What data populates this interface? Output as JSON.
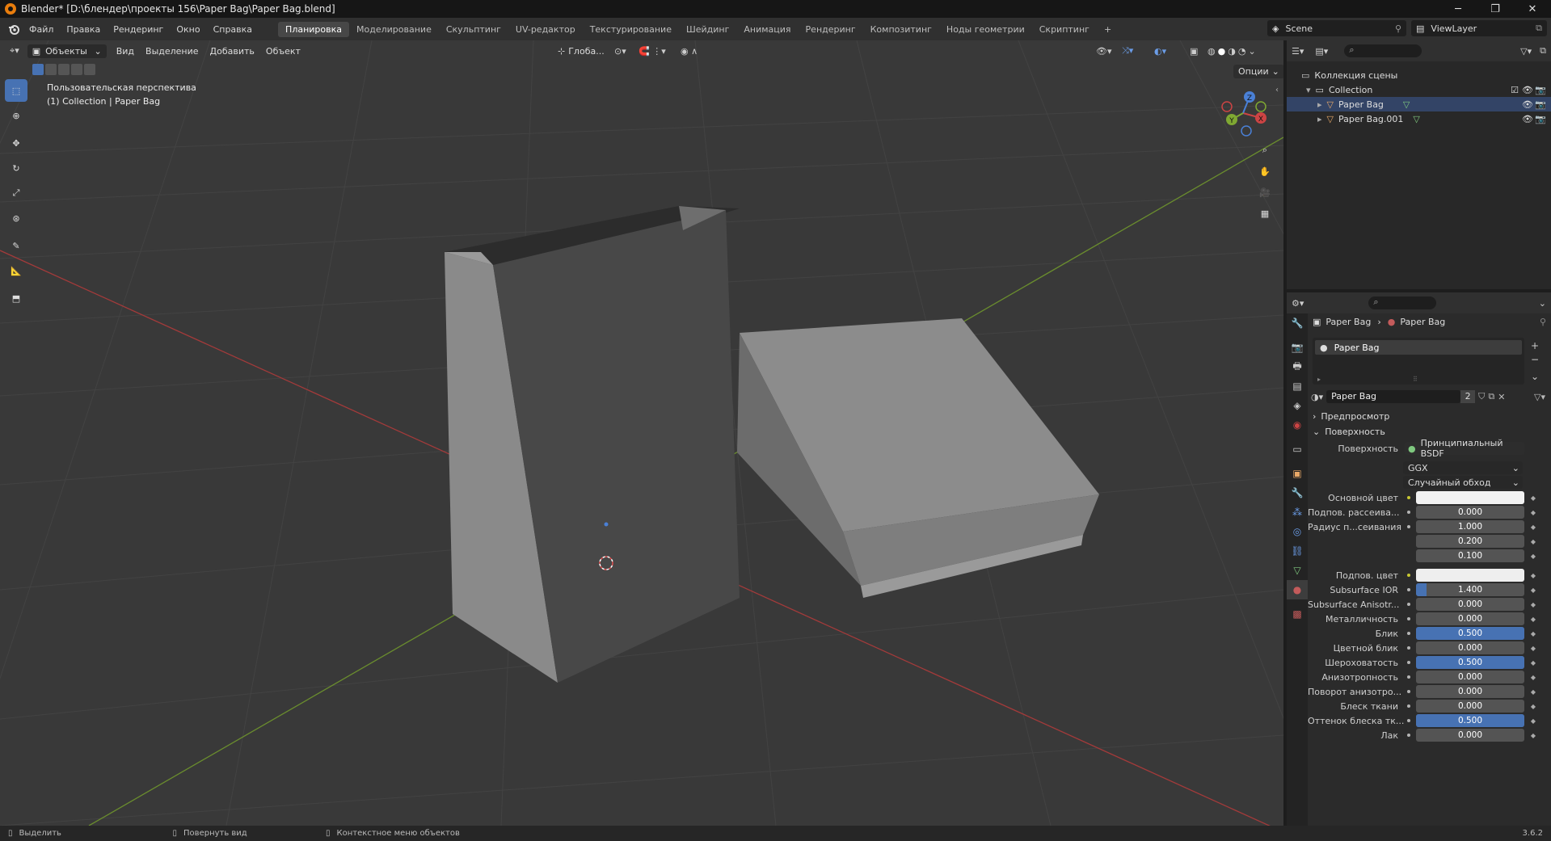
{
  "window": {
    "title": "Blender* [D:\\блендер\\проекты 156\\Paper Bag\\Paper Bag.blend]",
    "minimize": "─",
    "maximize": "❐",
    "close": "✕"
  },
  "menu": [
    "Файл",
    "Правка",
    "Рендеринг",
    "Окно",
    "Справка"
  ],
  "workspaces": [
    "Планировка",
    "Моделирование",
    "Скульптинг",
    "UV-редактор",
    "Текстурирование",
    "Шейдинг",
    "Анимация",
    "Рендеринг",
    "Композитинг",
    "Ноды геометрии",
    "Скриптинг"
  ],
  "active_workspace": "Планировка",
  "add_workspace": "+",
  "scene": {
    "name": "Scene",
    "view_layer": "ViewLayer"
  },
  "viewport": {
    "mode": "Объекты",
    "header_menu": [
      "Вид",
      "Выделение",
      "Добавить",
      "Объект"
    ],
    "orientation": "Глоба...",
    "options": "Опции",
    "perspective_label": "Пользовательская перспектива",
    "collection_label": "(1) Collection | Paper Bag",
    "gizmo_axes": {
      "x": "X",
      "y": "Y",
      "z": "Z"
    }
  },
  "outliner": {
    "root": "Коллекция сцены",
    "collection": "Collection",
    "objects": [
      "Paper Bag",
      "Paper Bag.001"
    ]
  },
  "properties": {
    "breadcrumb": [
      "Paper Bag",
      "Paper Bag"
    ],
    "material_slot": "Paper Bag",
    "material_name": "Paper Bag",
    "user_count": "2",
    "panels": {
      "preview": "Предпросмотр",
      "surface": "Поверхность"
    },
    "surface_label": "Поверхность",
    "surface_shader": "Принципиальный BSDF",
    "distribution": "GGX",
    "subsurface_method": "Случайный обход",
    "rows": [
      {
        "label": "Основной цвет",
        "value": "",
        "color": "#f2f2f2"
      },
      {
        "label": "Подпов. рассеива...",
        "value": "0.000",
        "fraction": 0
      },
      {
        "label": "Радиус п...сеивания",
        "value": "1.000",
        "fraction": 0
      },
      {
        "label": "",
        "value": "0.200",
        "fraction": 0
      },
      {
        "label": "",
        "value": "0.100",
        "fraction": 0
      },
      {
        "label": "Подпов. цвет",
        "value": "",
        "color": "#eeeeee"
      },
      {
        "label": "Subsurface IOR",
        "value": "1.400",
        "fraction": 0.1
      },
      {
        "label": "Subsurface Anisotr...",
        "value": "0.000",
        "fraction": 0
      },
      {
        "label": "Металличность",
        "value": "0.000",
        "fraction": 0
      },
      {
        "label": "Блик",
        "value": "0.500",
        "fraction": 1
      },
      {
        "label": "Цветной блик",
        "value": "0.000",
        "fraction": 0
      },
      {
        "label": "Шероховатость",
        "value": "0.500",
        "fraction": 1
      },
      {
        "label": "Анизотропность",
        "value": "0.000",
        "fraction": 0
      },
      {
        "label": "Поворот анизотро...",
        "value": "0.000",
        "fraction": 0
      },
      {
        "label": "Блеск ткани",
        "value": "0.000",
        "fraction": 0
      },
      {
        "label": "Оттенок блеска тк...",
        "value": "0.500",
        "fraction": 1
      },
      {
        "label": "Лак",
        "value": "0.000",
        "fraction": 0
      }
    ]
  },
  "statusbar": {
    "select": "Выделить",
    "rotate": "Повернуть вид",
    "context": "Контекстное меню объектов",
    "version": "3.6.2"
  },
  "colors": {
    "accent": "#4772b3",
    "axis_x": "#cc4444",
    "axis_y": "#7fa832",
    "axis_z": "#4a80d6"
  }
}
